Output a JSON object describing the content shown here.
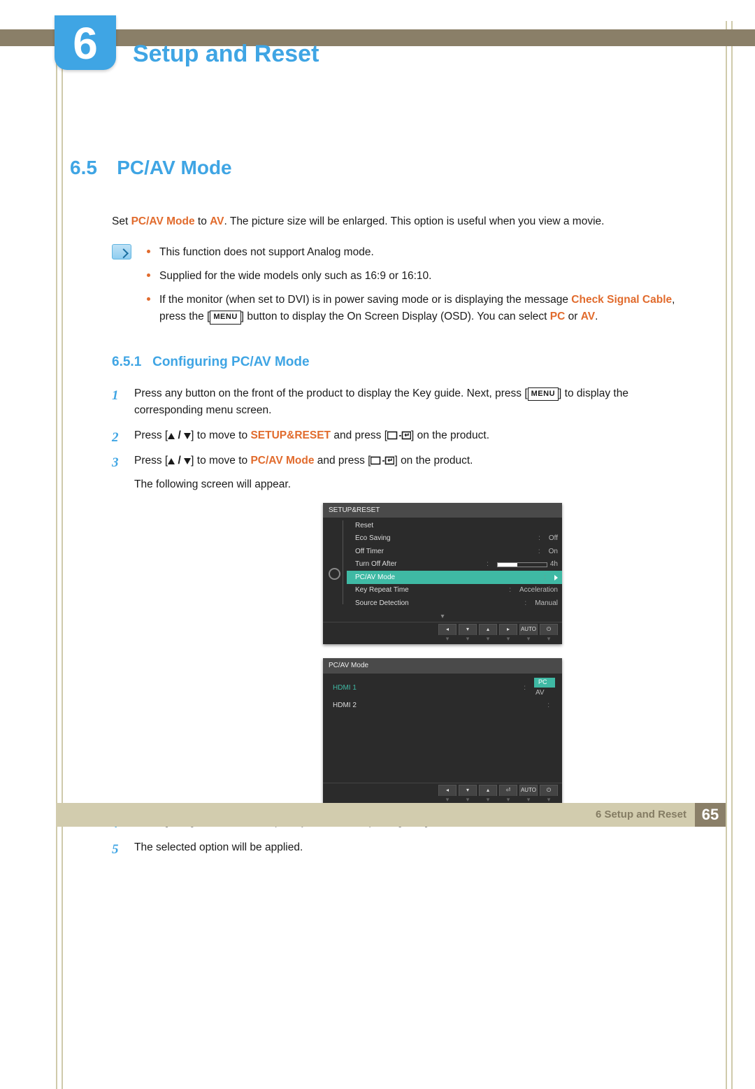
{
  "vlines": {
    "left1": 80,
    "left2": 88,
    "right1": 1038,
    "right2": 1046
  },
  "chapter": {
    "num": "6",
    "title": "Setup and Reset"
  },
  "section": {
    "num": "6.5",
    "title": "PC/AV Mode"
  },
  "intro": {
    "pre": "Set ",
    "kw": "PC/AV Mode",
    "mid": " to ",
    "kw2": "AV",
    "post": ". The picture size will be enlarged. This option is useful when you view a movie."
  },
  "notes": [
    "This function does not support Analog mode.",
    "Supplied for the wide models only such as 16:9 or 16:10."
  ],
  "note3": {
    "a": "If the monitor (when set to DVI) is in power saving mode or is displaying the message ",
    "b": "Check Signal Cable",
    "c": ", press the [",
    "menu": "MENU",
    "d": "] button to display the On Screen Display (OSD). You can select ",
    "e": "PC",
    "f": " or ",
    "g": "AV",
    "h": "."
  },
  "sub": {
    "num": "6.5.1",
    "title": "Configuring PC/AV Mode"
  },
  "steps": {
    "s1a": "Press any button on the front of the product to display the Key guide. Next, press [",
    "s1menu": "MENU",
    "s1b": "] to display the corresponding menu screen.",
    "s2a": "Press [",
    "s2b": "] to move to ",
    "s2k": "SETUP&RESET",
    "s2c": " and press [",
    "s2d": "] on the product.",
    "s3a": "Press [",
    "s3b": "] to move to ",
    "s3k": "PC/AV Mode",
    "s3c": " and press [",
    "s3d": "] on the product.",
    "s3e": "The following screen will appear.",
    "s4a": "Press [",
    "s4b": "] to move to the option you want and press [",
    "s4c": "].",
    "s5": "The selected option will be applied."
  },
  "osd1": {
    "title": "SETUP&RESET",
    "rows": [
      {
        "l": "Reset",
        "v": ""
      },
      {
        "l": "Eco Saving",
        "v": "Off"
      },
      {
        "l": "Off Timer",
        "v": "On"
      },
      {
        "l": "Turn Off After",
        "v": "4h",
        "slider": true
      },
      {
        "l": "PC/AV Mode",
        "v": "",
        "sel": true
      },
      {
        "l": "Key Repeat Time",
        "v": "Acceleration"
      },
      {
        "l": "Source Detection",
        "v": "Manual"
      }
    ],
    "foot": [
      "◂",
      "▾",
      "▴",
      "▸",
      "AUTO",
      "⏻"
    ]
  },
  "osd2": {
    "title": "PC/AV Mode",
    "rows": [
      {
        "l": "HDMI 1",
        "pc": "PC",
        "av": "AV",
        "hl": true
      },
      {
        "l": "HDMI 2",
        "v": ""
      }
    ],
    "foot": [
      "◂",
      "▾",
      "▴",
      "⏎",
      "AUTO",
      "⏻"
    ]
  },
  "footer": {
    "label": "6 Setup and Reset",
    "page": "65"
  }
}
